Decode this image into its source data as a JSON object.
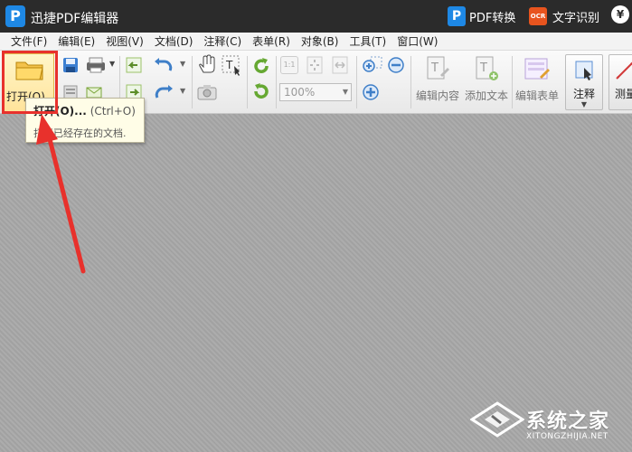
{
  "app": {
    "logo_letter": "P",
    "title": "迅捷PDF编辑器",
    "pdf_convert_label": "PDF转换",
    "pdf_convert_icon": "pdf-convert-icon",
    "ocr_badge": "OCR",
    "ocr_label": "文字识别",
    "yen_symbol": "¥"
  },
  "menu": {
    "items": [
      "文件(F)",
      "编辑(E)",
      "视图(V)",
      "文档(D)",
      "注释(C)",
      "表单(R)",
      "对象(B)",
      "工具(T)",
      "窗口(W)"
    ]
  },
  "toolbar": {
    "open_label": "打开(O)...",
    "zoom_value": "100%",
    "edit_content_label": "编辑内容",
    "add_text_label": "添加文本",
    "edit_form_label": "编辑表单",
    "annotate_label": "注释",
    "measure_label": "测量",
    "zoom_ratio_label": "1:1",
    "accent_color": "#ffe39a",
    "highlight_color": "#e8312c"
  },
  "tooltip": {
    "title": "打开(O)...",
    "shortcut": "(Ctrl+O)",
    "description": "打开已经存在的文档."
  },
  "watermark": {
    "text": "系统之家",
    "subtext": "XITONGZHIJIA.NET"
  }
}
